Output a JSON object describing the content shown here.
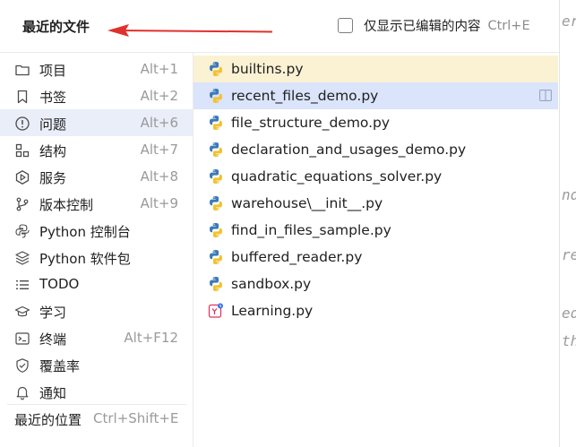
{
  "header": {
    "title": "最近的文件",
    "checkbox_label": "仅显示已编辑的内容",
    "checkbox_shortcut": "Ctrl+E",
    "checkbox_checked": false
  },
  "nav": {
    "items": [
      {
        "label": "项目",
        "shortcut": "Alt+1",
        "icon": "folder-icon"
      },
      {
        "label": "书签",
        "shortcut": "Alt+2",
        "icon": "bookmark-icon"
      },
      {
        "label": "问题",
        "shortcut": "Alt+6",
        "icon": "problems-icon",
        "selected": true
      },
      {
        "label": "结构",
        "shortcut": "Alt+7",
        "icon": "structure-icon"
      },
      {
        "label": "服务",
        "shortcut": "Alt+8",
        "icon": "services-icon"
      },
      {
        "label": "版本控制",
        "shortcut": "Alt+9",
        "icon": "vcs-branch-icon"
      },
      {
        "label": "Python 控制台",
        "shortcut": "",
        "icon": "python-console-icon"
      },
      {
        "label": "Python 软件包",
        "shortcut": "",
        "icon": "packages-icon"
      },
      {
        "label": "TODO",
        "shortcut": "",
        "icon": "todo-list-icon"
      },
      {
        "label": "学习",
        "shortcut": "",
        "icon": "learn-icon"
      },
      {
        "label": "终端",
        "shortcut": "Alt+F12",
        "icon": "terminal-icon"
      },
      {
        "label": "覆盖率",
        "shortcut": "",
        "icon": "coverage-shield-icon"
      },
      {
        "label": "通知",
        "shortcut": "",
        "icon": "bell-icon"
      }
    ],
    "recent_locations_label": "最近的位置",
    "recent_locations_shortcut": "Ctrl+Shift+E"
  },
  "files": [
    {
      "name": "builtins.py",
      "icon": "python-file-icon",
      "state": "highlighted"
    },
    {
      "name": "recent_files_demo.py",
      "icon": "python-file-icon",
      "state": "selected"
    },
    {
      "name": "file_structure_demo.py",
      "icon": "python-file-icon"
    },
    {
      "name": "declaration_and_usages_demo.py",
      "icon": "python-file-icon"
    },
    {
      "name": "quadratic_equations_solver.py",
      "icon": "python-file-icon"
    },
    {
      "name": "warehouse\\__init__.py",
      "icon": "python-file-icon"
    },
    {
      "name": "find_in_files_sample.py",
      "icon": "python-file-icon"
    },
    {
      "name": "buffered_reader.py",
      "icon": "python-file-icon"
    },
    {
      "name": "sandbox.py",
      "icon": "python-file-icon"
    },
    {
      "name": "Learning.py",
      "icon": "learning-file-icon"
    }
  ],
  "background_code": [
    "er",
    "nd",
    "rem",
    "ed",
    "th"
  ],
  "colors": {
    "selected_bg": "#dae4fb",
    "highlight_bg": "#fbf1d3",
    "nav_selected_bg": "#e9eef9",
    "arrow": "#e0312d"
  }
}
